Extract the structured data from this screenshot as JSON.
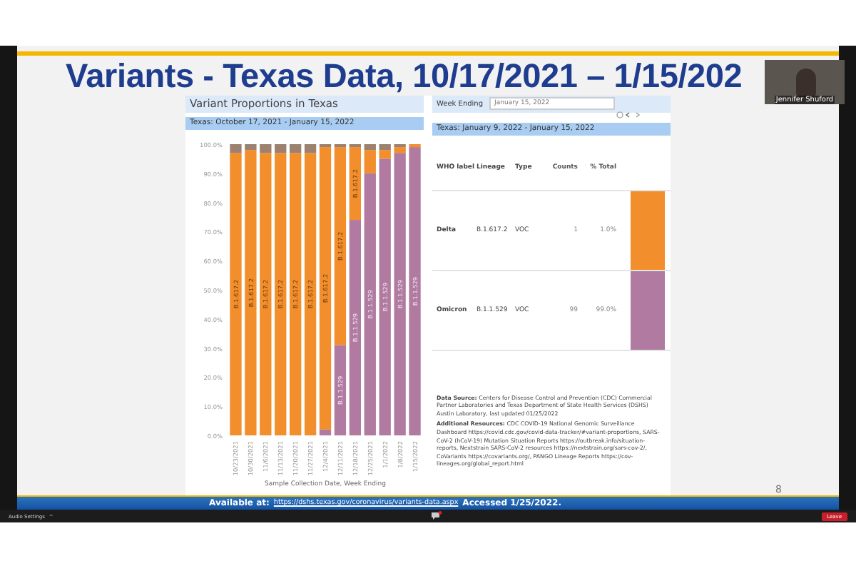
{
  "slide": {
    "title": "Variants - Texas Data, 10/17/2021 – 1/15/202",
    "page_number": "8",
    "left_panel": {
      "title": "Variant Proportions in Texas",
      "subtitle": "Texas: October 17, 2021 - January 15, 2022",
      "chart_data": {
        "type": "bar",
        "stacked": true,
        "xlabel": "Sample Collection Date, Week Ending",
        "categories": [
          "10/23/2021",
          "10/30/2021",
          "11/6/2021",
          "11/13/2021",
          "11/20/2021",
          "11/27/2021",
          "12/4/2021",
          "12/11/2021",
          "12/18/2021",
          "12/25/2021",
          "1/1/2022",
          "1/8/2022",
          "1/15/2022"
        ],
        "series": [
          {
            "name": "B.1.1.529",
            "color": "#b07aa1",
            "values": [
              0,
              0,
              0,
              0,
              0,
              0,
              2,
              31,
              74,
              90,
              95,
              97,
              99
            ]
          },
          {
            "name": "B.1.617.2",
            "color": "#f28e2b",
            "values": [
              97,
              98,
              97,
              97,
              97,
              97,
              97,
              68,
              25,
              8,
              3,
              2,
              1
            ]
          },
          {
            "color": "#9c8070",
            "values": [
              3,
              2,
              3,
              3,
              3,
              3,
              1,
              1,
              1,
              2,
              2,
              1,
              0
            ]
          }
        ],
        "ylim": [
          0,
          100
        ],
        "yticks": [
          {
            "value": 0,
            "label": "0.0%"
          },
          {
            "value": 10,
            "label": "10.0%"
          },
          {
            "value": 20,
            "label": "20.0%"
          },
          {
            "value": 30,
            "label": "30.0%"
          },
          {
            "value": 40,
            "label": "40.0%"
          },
          {
            "value": 50,
            "label": "50.0%"
          },
          {
            "value": 60,
            "label": "60.0%"
          },
          {
            "value": 70,
            "label": "70.0%"
          },
          {
            "value": 80,
            "label": "80.0%"
          },
          {
            "value": 90,
            "label": "90.0%"
          },
          {
            "value": 100,
            "label": "100.0%"
          }
        ]
      }
    },
    "right_panel": {
      "week_label": "Week Ending",
      "week_value": "January 15, 2022",
      "subtitle": "Texas: January 9, 2022 - January 15, 2022",
      "columns": [
        "WHO label",
        "Lineage",
        "Type",
        "Counts",
        "% Total"
      ],
      "rows": [
        {
          "cells": [
            "Delta",
            "B.1.617.2",
            "VOC",
            "1",
            "1.0%"
          ],
          "color": "#f28e2b"
        },
        {
          "cells": [
            "Omicron",
            "B.1.1.529",
            "VOC",
            "99",
            "99.0%"
          ],
          "color": "#b07aa1"
        }
      ],
      "source_label": "Data Source:",
      "source_text": "Centers for Disease Control and Prevention (CDC) Commercial Partner Laboratories and Texas Department of State Health Services (DSHS) Austin Laboratory, last updated 01/25/2022",
      "resources_label": "Additional Resources:",
      "resources_text": "CDC COVID-19 National Genomic Surveillance Dashboard https://covid.cdc.gov/covid-data-tracker/#variant-proportions, SARS-CoV-2 (hCoV-19) Mutation Situation Reports https://outbreak.info/situation-reports, Nextstrain SARS-CoV-2 resources https://nextstrain.org/sars-cov-2/, CoVariants https://covariants.org/, PANGO Lineage Reports https://cov-lineages.org/global_report.html"
    },
    "footer_prefix": "Available at:",
    "footer_link": "https://dshs.texas.gov/coronavirus/variants-data.aspx",
    "footer_suffix": "Accessed 1/25/2022."
  },
  "video_tile": {
    "name": "Jennifer Shuford"
  },
  "toolbar": {
    "audio": "Audio Settings",
    "caret": "^",
    "leave": "Leave"
  }
}
